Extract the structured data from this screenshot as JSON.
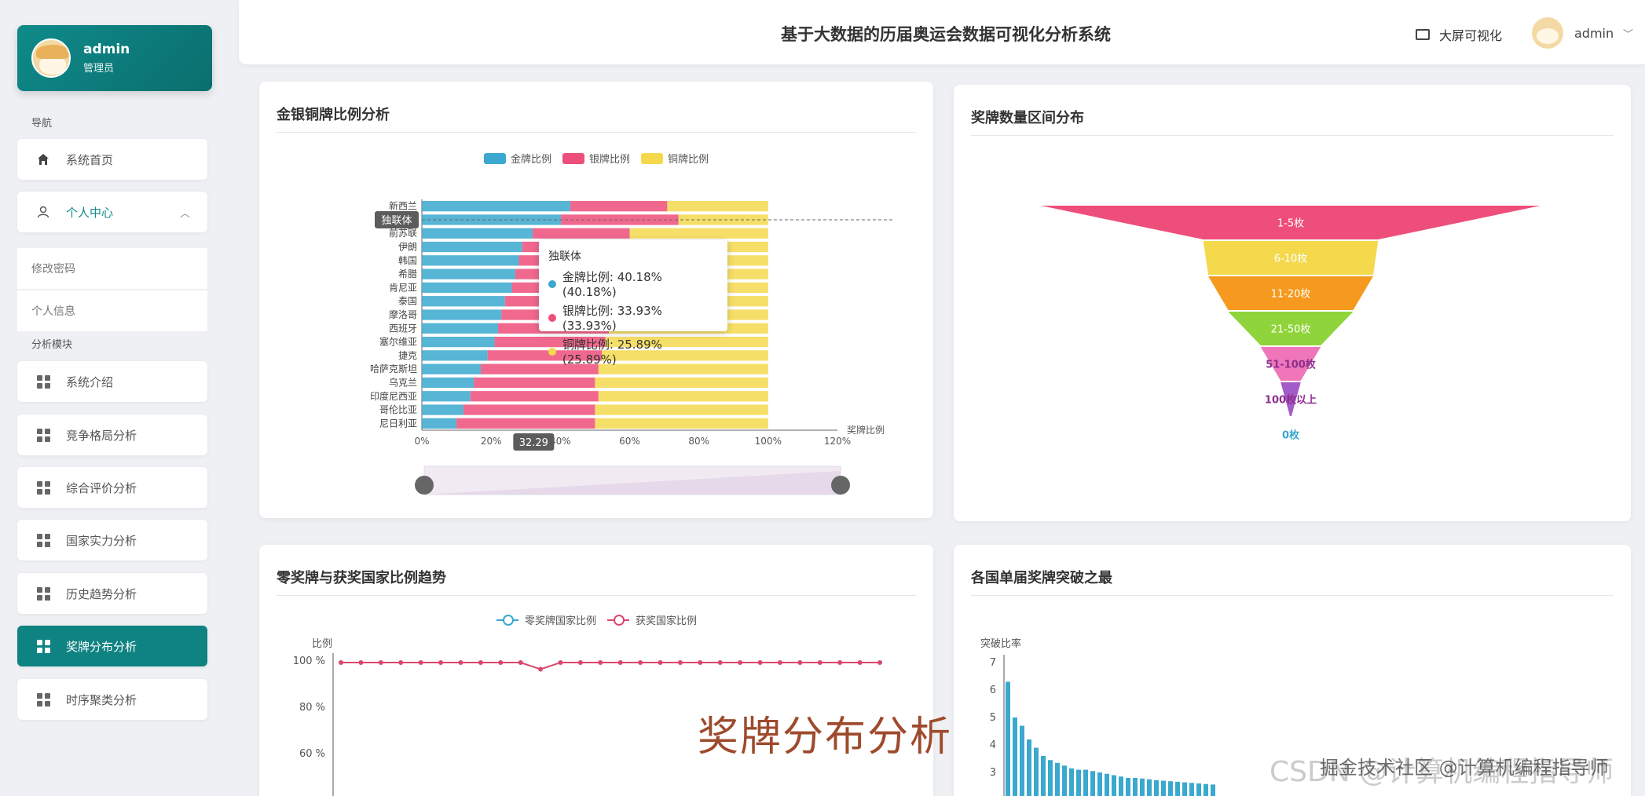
{
  "user": {
    "name": "admin",
    "role": "管理员"
  },
  "nav": {
    "section_nav": "导航",
    "home": "系统首页",
    "personal_center": "个人中心",
    "change_password": "修改密码",
    "personal_info": "个人信息",
    "section_analysis": "分析模块",
    "items": [
      "系统介绍",
      "竞争格局分析",
      "综合评价分析",
      "国家实力分析",
      "历史趋势分析",
      "奖牌分布分析",
      "时序聚类分析"
    ],
    "active_item": "奖牌分布分析"
  },
  "header": {
    "title": "基于大数据的历届奥运会数据可视化分析系统",
    "bigscreen": "大屏可视化",
    "username": "admin"
  },
  "panels": {
    "p1_title": "金银铜牌比例分析",
    "p2_title": "奖牌数量区间分布",
    "p3_title": "零奖牌与获奖国家比例趋势",
    "p4_title": "各国单届奖牌突破之最"
  },
  "colors": {
    "gold": "#3aa8cf",
    "silver": "#ee4e7a",
    "bronze": "#f4d94d",
    "accent": "#0f8282"
  },
  "tooltip": {
    "title": "独联体",
    "rows": [
      "金牌比例: 40.18% (40.18%)",
      "银牌比例: 33.93% (33.93%)",
      "铜牌比例: 25.89% (25.89%)"
    ]
  },
  "axis_pointer": {
    "y_label": "独联体",
    "x_label": "32.29"
  },
  "chart_data": [
    {
      "type": "bar",
      "stacked": true,
      "orientation": "horizontal",
      "title": "金银铜牌比例分析",
      "legend": [
        "金牌比例",
        "银牌比例",
        "铜牌比例"
      ],
      "categories": [
        "尼日利亚",
        "哥伦比亚",
        "印度尼西亚",
        "乌克兰",
        "哈萨克斯坦",
        "捷克",
        "塞尔维亚",
        "西班牙",
        "摩洛哥",
        "泰国",
        "肯尼亚",
        "希腊",
        "韩国",
        "伊朗",
        "前苏联",
        "独联体",
        "新西兰"
      ],
      "series": [
        {
          "name": "金牌比例",
          "values": [
            10,
            12,
            14,
            15,
            17,
            19,
            21,
            22,
            23,
            24,
            26,
            27,
            28,
            29,
            32,
            40.18,
            42.86
          ]
        },
        {
          "name": "银牌比例",
          "values": [
            40,
            38,
            37,
            35,
            34,
            33,
            32,
            32,
            30,
            30,
            30,
            29,
            29,
            29,
            28,
            33.93,
            28
          ]
        },
        {
          "name": "铜牌比例",
          "values": [
            50,
            50,
            49,
            50,
            49,
            48,
            47,
            46,
            47,
            46,
            44,
            44,
            43,
            42,
            40,
            25.89,
            29.14
          ]
        }
      ],
      "x_ticks": [
        "0%",
        "20%",
        "40%",
        "60%",
        "80%",
        "100%",
        "120%"
      ],
      "xlabel": "奖牌比例",
      "xlim": [
        0,
        120
      ]
    },
    {
      "type": "funnel",
      "title": "奖牌数量区间分布",
      "labels": [
        "1-5枚",
        "6-10枚",
        "11-20枚",
        "21-50枚",
        "51-100枚",
        "100枚以上",
        "0枚"
      ],
      "values": [
        100,
        35,
        33,
        25,
        12,
        4,
        0
      ],
      "colors": [
        "#ee4e7a",
        "#f4d94d",
        "#f59a1e",
        "#8fd43a",
        "#ef76b8",
        "#a35bc9",
        "#3aa8cf"
      ]
    },
    {
      "type": "line",
      "title": "零奖牌与获奖国家比例趋势",
      "legend": [
        "零奖牌国家比例",
        "获奖国家比例"
      ],
      "ylabel": "比例",
      "y_ticks": [
        "100 %",
        "80 %",
        "60 %"
      ],
      "ylim": [
        50,
        100
      ],
      "series": [
        {
          "name": "获奖国家比例",
          "values": [
            100,
            100,
            100,
            100,
            100,
            100,
            100,
            100,
            100,
            100,
            95,
            100,
            100,
            100,
            100,
            100,
            100,
            100,
            100,
            100,
            100,
            100,
            100,
            100,
            100,
            100,
            100,
            100
          ]
        }
      ]
    },
    {
      "type": "bar",
      "title": "各国单届奖牌突破之最",
      "ylabel": "突破比率",
      "y_ticks": [
        "7",
        "6",
        "5",
        "4",
        "3"
      ],
      "ylim": [
        2.2,
        7
      ],
      "values": [
        6.3,
        5.0,
        4.7,
        4.2,
        3.9,
        3.6,
        3.45,
        3.35,
        3.25,
        3.15,
        3.1,
        3.1,
        3.05,
        3.0,
        2.95,
        2.9,
        2.85,
        2.8,
        2.8,
        2.78,
        2.75,
        2.72,
        2.7,
        2.68,
        2.66,
        2.64,
        2.62,
        2.6,
        2.58,
        2.56
      ]
    }
  ],
  "overlay_title": "奖牌分布分析",
  "watermark": "CSDN @计算机编程指导师",
  "watermark_overlay": "掘金技术社区 @计算机编程指导师"
}
